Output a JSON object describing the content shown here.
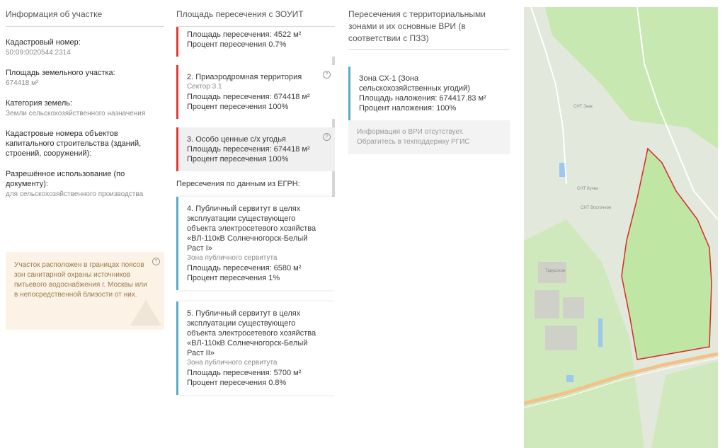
{
  "info": {
    "title": "Информация об участке",
    "cadastral_label": "Кадастровый номер:",
    "cadastral_value": "50:09:0020544:2314",
    "area_label": "Площадь земельного участка:",
    "area_value": "674418 м²",
    "category_label": "Категория земель:",
    "category_value": "Земли сельскохозяйственного назначения",
    "oks_label": "Кадастровые номера объектов капитального строительства (зданий, строений, сооружений):",
    "use_label": "Разрешённое использование (по документу):",
    "use_value": "для сельскохозяйственного производства",
    "warning": "Участок расположен в границах поясов зон санитарной охраны источников питьевого водоснабжения г. Москвы или в непосредственной близости от них."
  },
  "zouit": {
    "title": "Площадь пересечения с ЗОУИТ",
    "card1": {
      "area": "Площадь пересечения: 4522 м²",
      "percent": "Процент пересечения 0.7%"
    },
    "card2": {
      "title": "2. Приаэродромная территория",
      "sub": "Сектор 3.1",
      "area": "Площадь пересечения: 674418 м²",
      "percent": "Процент пересечения 100%"
    },
    "card3": {
      "title": "3. Особо ценные с/х угодья",
      "area": "Площадь пересечения: 674418 м²",
      "percent": "Процент пересечения 100%"
    },
    "egrn_title": "Пересечения по данным из ЕГРН:",
    "card4": {
      "title": "4. Публичный сервитут в целях эксплуатации существующего объекта электросетевого хозяйства «ВЛ-110кВ Солнечногорск-Белый Раст I»",
      "sub": "Зона публичного сервитута",
      "area": "Площадь пересечения: 6580 м²",
      "percent": "Процент пересечения 1%"
    },
    "card5": {
      "title": "5. Публичный сервитут в целях эксплуатации существующего объекта электросетевого хозяйства «ВЛ-110кВ Солнечногорск-Белый Раст II»",
      "sub": "Зона публичного сервитута",
      "area": "Площадь пересечения: 5700 м²",
      "percent": "Процент пересечения 0.8%"
    }
  },
  "zones": {
    "title": "Пересечения с территориальными зонами и их основные ВРИ (в соответствии с ПЗЗ)",
    "zone": {
      "name": "Зона СХ-1 (Зона сельскохозяйственных угодий)",
      "area": "Площадь наложения: 674417.83 м²",
      "percent": "Процент наложения: 100%"
    },
    "note": "Информация о ВРИ отсутствует. Обратитесь в техподдержку РГИС"
  },
  "map": {
    "labels": [
      "СНТ Знак",
      "СНТ Кучки",
      "СНТ Восточное",
      "Тарусское"
    ],
    "parcel_fill": "#bfe6a2",
    "parcel_border": "#d62b2b"
  }
}
